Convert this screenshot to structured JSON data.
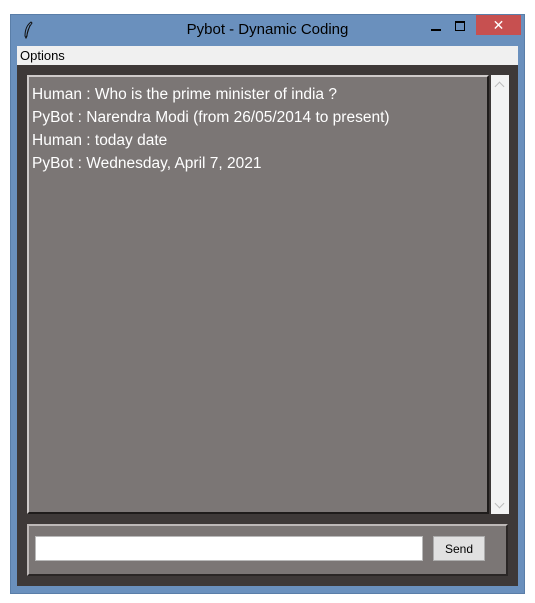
{
  "window": {
    "title": "Pybot - Dynamic Coding",
    "close_glyph": "✕"
  },
  "menubar": {
    "items": [
      {
        "label": "Options"
      }
    ]
  },
  "chat": {
    "messages": [
      {
        "text": "Human : Who is the prime minister of india ?"
      },
      {
        "text": "PyBot : Narendra Modi (from 26/05/2014 to present)"
      },
      {
        "text": "Human : today date"
      },
      {
        "text": "PyBot : Wednesday, April 7, 2021"
      }
    ],
    "background_color": "#7b7675",
    "text_color": "#ffffff"
  },
  "input": {
    "value": "",
    "placeholder": ""
  },
  "send_button": {
    "label": "Send"
  },
  "colors": {
    "titlebar": "#6a90bd",
    "close_button": "#c75050",
    "client_background": "#3e3938"
  },
  "icons": {
    "app": "feather-icon",
    "minimize": "minimize-icon",
    "maximize": "maximize-icon",
    "close": "close-icon"
  }
}
